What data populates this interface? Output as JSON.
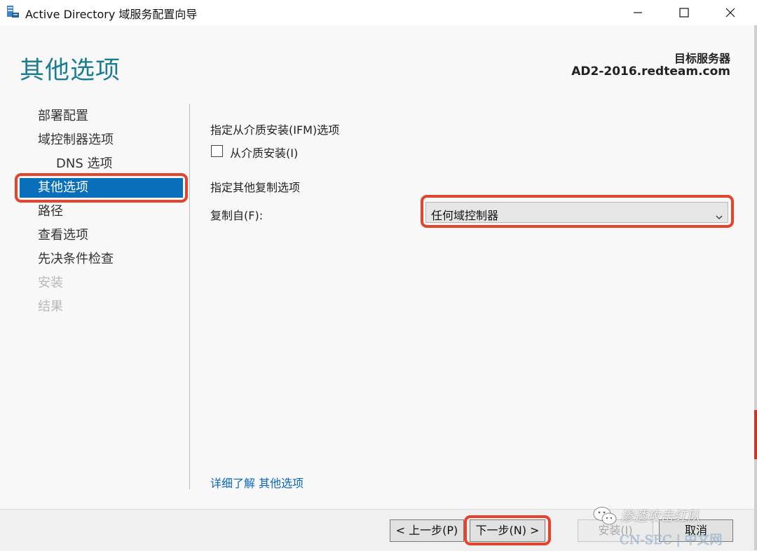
{
  "window": {
    "title": "Active Directory 域服务配置向导",
    "icons": {
      "app": "server-icon",
      "minimize": "minimize-icon",
      "maximize": "maximize-icon",
      "close": "close-icon"
    }
  },
  "header": {
    "page_title": "其他选项",
    "target_label": "目标服务器",
    "target_server": "AD2-2016.redteam.com"
  },
  "nav": {
    "items": [
      {
        "label": "部署配置",
        "state": "normal"
      },
      {
        "label": "域控制器选项",
        "state": "normal"
      },
      {
        "label": "DNS 选项",
        "state": "sub"
      },
      {
        "label": "其他选项",
        "state": "active"
      },
      {
        "label": "路径",
        "state": "normal"
      },
      {
        "label": "查看选项",
        "state": "normal"
      },
      {
        "label": "先决条件检查",
        "state": "normal"
      },
      {
        "label": "安装",
        "state": "disabled"
      },
      {
        "label": "结果",
        "state": "disabled"
      }
    ]
  },
  "content": {
    "ifm_section_title": "指定从介质安装(IFM)选项",
    "ifm_checkbox_label": "从介质安装(I)",
    "ifm_checked": false,
    "replication_section_title": "指定其他复制选项",
    "replicate_from_label": "复制自(F):",
    "replicate_from_value": "任何域控制器",
    "learn_more_link": "详细了解 其他选项"
  },
  "footer": {
    "prev_label": "< 上一步(P)",
    "next_label": "下一步(N) >",
    "install_label": "安装(I)",
    "cancel_label": "取消"
  },
  "watermark": {
    "line1": "渗透攻击红队",
    "line2": "CN-SEC | 中文网"
  },
  "colors": {
    "accent": "#1a7d92",
    "selection": "#0a6fbb",
    "highlight": "#e4432d",
    "link": "#0a66c2"
  }
}
